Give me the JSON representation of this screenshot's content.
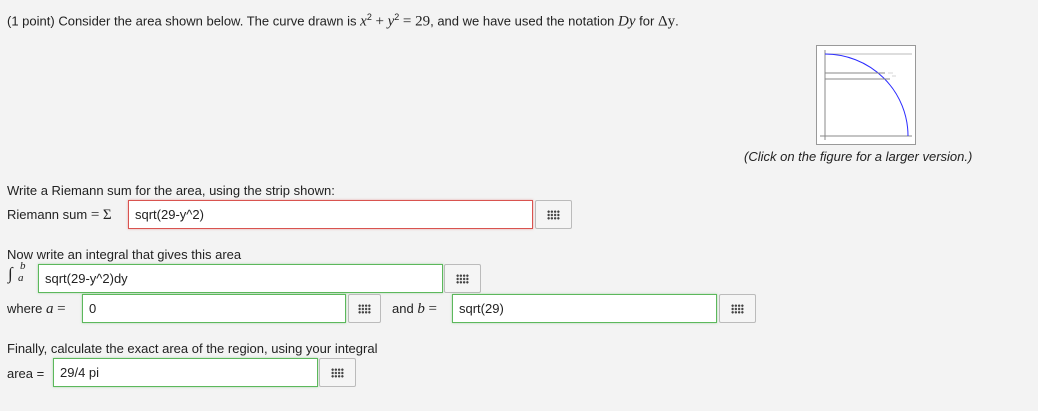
{
  "header": {
    "points": "(1 point)",
    "intro": "Consider the area shown below. The curve drawn is",
    "equation_x": "x",
    "equation_plus": "+",
    "equation_y": "y",
    "equation_rhs": "= 29",
    "notation_text": ", and we have used the notation",
    "notation_dy": "Dy",
    "notation_for": "for",
    "notation_delta": "Δy",
    "period": "."
  },
  "figure": {
    "caption": "(Click on the figure for a larger version.)",
    "curve_color": "#2b2bff"
  },
  "riemann": {
    "prompt": "Write a Riemann sum for the area, using the strip shown:",
    "label": "Riemann sum",
    "equals": "=",
    "sigma": "Σ",
    "value": "sqrt(29-y^2)"
  },
  "integral": {
    "prompt": "Now write an integral that gives this area",
    "symbol": "∫",
    "upper": "b",
    "lower": "a",
    "value": "sqrt(29-y^2)dy",
    "where": "where",
    "a_var": "a",
    "equals": "=",
    "a_value": "0",
    "and": "and",
    "b_var": "b",
    "b_value": "sqrt(29)"
  },
  "final": {
    "prompt": "Finally, calculate the exact area of the region, using your integral",
    "label": "area =",
    "value": "29/4 pi"
  }
}
